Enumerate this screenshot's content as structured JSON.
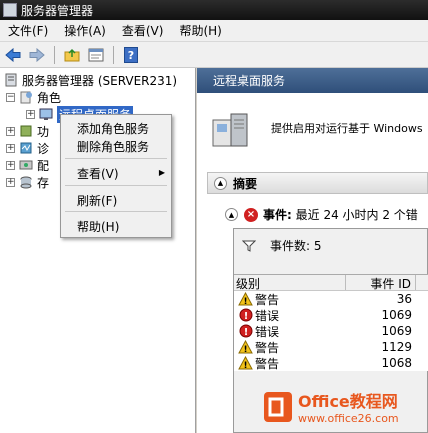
{
  "window": {
    "title": "服务器管理器"
  },
  "menu": [
    "文件(F)",
    "操作(A)",
    "查看(V)",
    "帮助(H)"
  ],
  "toolbar": [
    "back-icon",
    "forward-icon",
    "folder-up-icon",
    "properties-icon",
    "help-icon"
  ],
  "tree": {
    "root": "服务器管理器 (SERVER231)",
    "roles": "角色",
    "selected": "远程桌面服务",
    "partial": [
      "功",
      "诊",
      "配",
      "存"
    ]
  },
  "context_menu": {
    "add_role_services": "添加角色服务",
    "remove_role_services": "删除角色服务",
    "view": "查看(V)",
    "refresh": "刷新(F)",
    "help": "帮助(H)"
  },
  "right": {
    "header": "远程桌面服务",
    "description": "提供启用对运行基于 Windows",
    "summary": "摘要",
    "events_label": "事件:",
    "events_text": "最近 24 小时内 2 个错",
    "event_count": "事件数: 5",
    "columns": [
      "级别",
      "事件 ID"
    ],
    "events": [
      {
        "level": "警告",
        "type": "warning",
        "id": "36"
      },
      {
        "level": "错误",
        "type": "error",
        "id": "1069"
      },
      {
        "level": "错误",
        "type": "error",
        "id": "1069"
      },
      {
        "level": "警告",
        "type": "warning",
        "id": "1129"
      },
      {
        "level": "警告",
        "type": "warning",
        "id": "1068"
      }
    ]
  },
  "watermark": {
    "brand": "Office教程网",
    "url": "www.office26.com"
  },
  "colors": {
    "header": "#3b5b86",
    "selection": "#3168c6",
    "error": "#d02020",
    "warning": "#f2c21a",
    "brand": "#e8571e"
  }
}
